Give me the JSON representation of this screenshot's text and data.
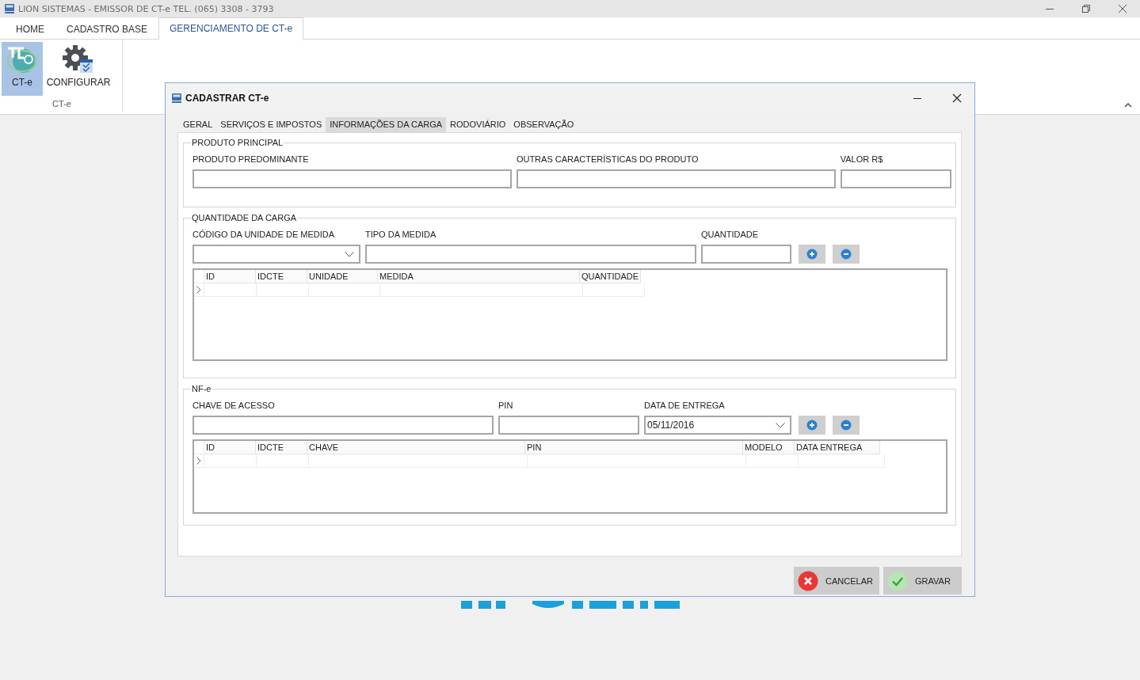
{
  "app": {
    "title": "LION SISTEMAS - EMISSOR DE CT-e  TEL. (065) 3308 - 3793"
  },
  "ribbon": {
    "tabs": [
      {
        "label": "HOME",
        "selected": false
      },
      {
        "label": "CADASTRO BASE",
        "selected": false
      },
      {
        "label": "GERENCIAMENTO DE CT-e",
        "selected": true
      }
    ],
    "buttons": [
      {
        "label": "CT-e",
        "kind": "cte",
        "selected": true
      },
      {
        "label": "CONFIGURAR",
        "kind": "gear",
        "selected": false
      }
    ],
    "group_label": "CT-e"
  },
  "dialog": {
    "title": "CADASTRAR  CT-e",
    "tabs": [
      {
        "label": "GERAL",
        "selected": false
      },
      {
        "label": "SERVIÇOS E IMPOSTOS",
        "selected": false
      },
      {
        "label": "INFORMAÇÕES DA CARGA",
        "selected": true
      },
      {
        "label": "RODOVIÁRIO",
        "selected": false
      },
      {
        "label": "OBSERVAÇÃO",
        "selected": false
      }
    ],
    "groups": [
      {
        "title": "PRODUTO PRINCIPAL",
        "fields": [
          {
            "label": "PRODUTO PREDOMINANTE",
            "kind": "text"
          },
          {
            "label": "OUTRAS CARACTERÍSTICAS DO PRODUTO",
            "kind": "text"
          },
          {
            "label": "VALOR R$",
            "kind": "text"
          }
        ]
      },
      {
        "title": "QUANTIDADE DA CARGA",
        "fields": [
          {
            "label": "CÓDIGO DA UNIDADE DE MEDIDA",
            "kind": "combo"
          },
          {
            "label": "TIPO DA MEDIDA",
            "kind": "text"
          },
          {
            "label": "QUANTIDADE",
            "kind": "text"
          }
        ],
        "add_remove": true,
        "grid": {
          "columns": [
            "ID",
            "IDCTE",
            "UNIDADE",
            "MEDIDA",
            "QUANTIDADE"
          ]
        }
      },
      {
        "title": "NF-e",
        "fields": [
          {
            "label": "CHAVE DE ACESSO",
            "kind": "text"
          },
          {
            "label": "PIN",
            "kind": "text"
          },
          {
            "label": "DATA DE ENTREGA",
            "kind": "combo",
            "value": "05/11/2016"
          }
        ],
        "add_remove": true,
        "grid": {
          "columns": [
            "ID",
            "IDCTE",
            "CHAVE",
            "PIN",
            "MODELO",
            "DATA ENTREGA"
          ]
        }
      }
    ],
    "buttons": [
      {
        "label": "CANCELAR",
        "kind": "cancel"
      },
      {
        "label": "GRAVAR",
        "kind": "save"
      }
    ]
  }
}
